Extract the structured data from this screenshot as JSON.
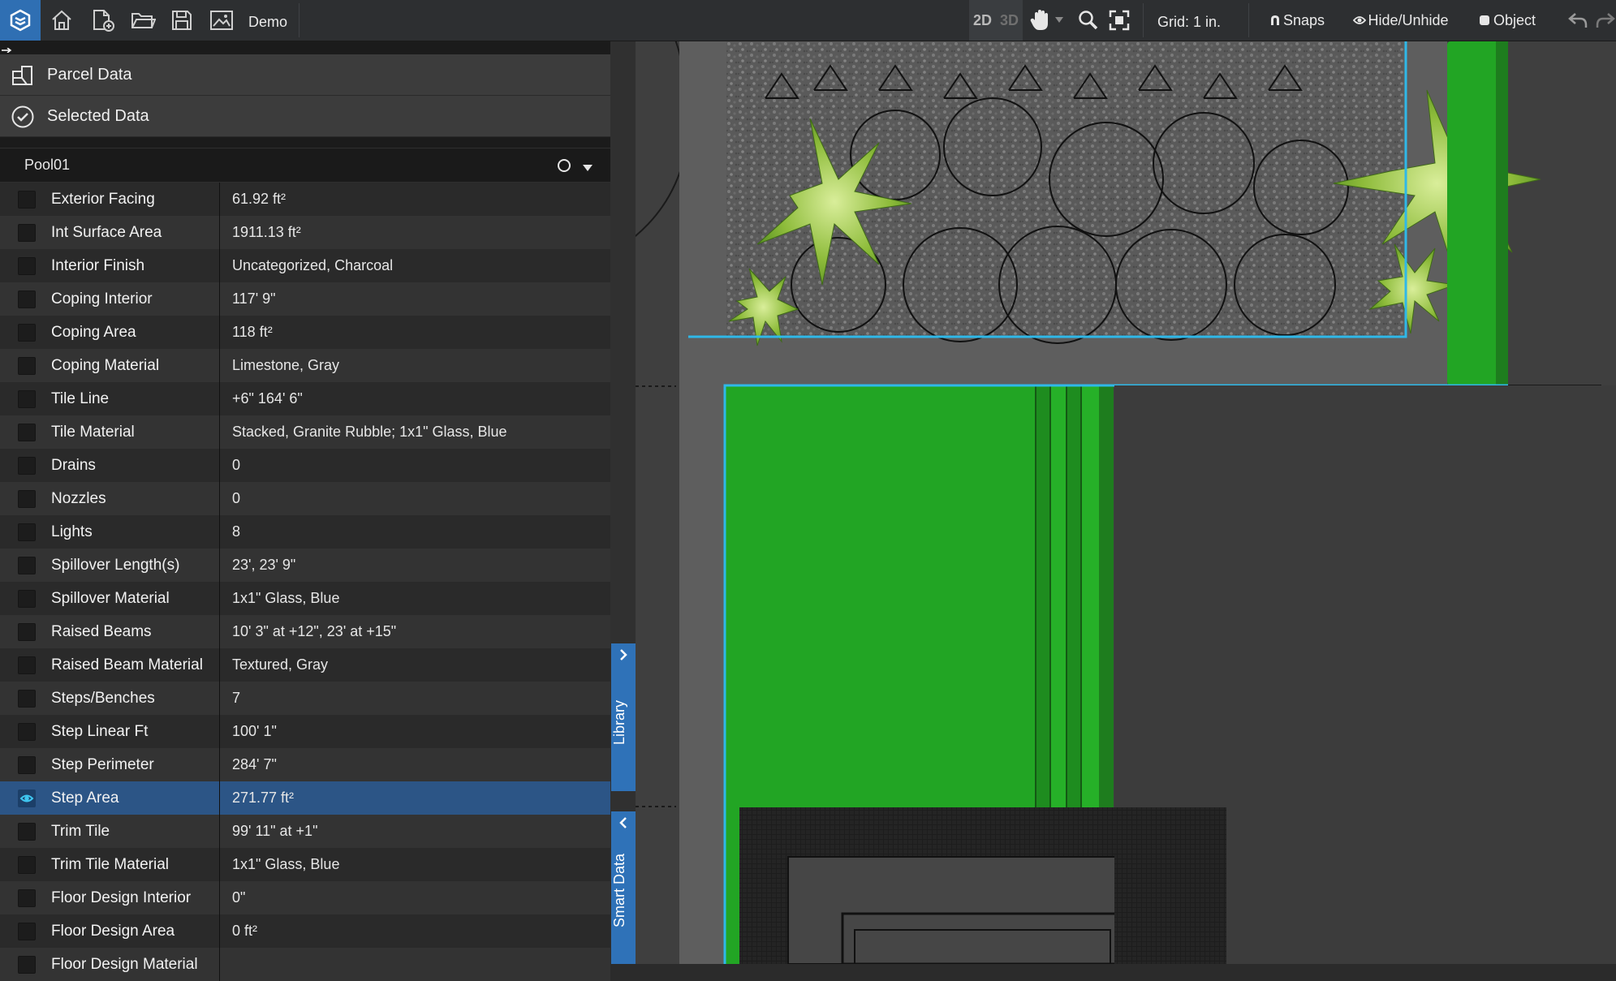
{
  "toolbar": {
    "project_name": "Demo",
    "view_2d": "2D",
    "view_3d": "3D",
    "grid_label": "Grid: 1 in.",
    "snaps_label": "Snaps",
    "hide_unhide_label": "Hide/Unhide",
    "object_label": "Object"
  },
  "panel": {
    "parcel_data_label": "Parcel Data",
    "selected_data_label": "Selected Data",
    "pool_name": "Pool01",
    "rows": [
      {
        "label": "Exterior Facing",
        "value": "61.92 ft²"
      },
      {
        "label": "Int Surface Area",
        "value": "1911.13 ft²"
      },
      {
        "label": "Interior Finish",
        "value": "Uncategorized, Charcoal"
      },
      {
        "label": "Coping Interior",
        "value": "117' 9\""
      },
      {
        "label": "Coping Area",
        "value": "118 ft²"
      },
      {
        "label": "Coping Material",
        "value": "Limestone, Gray"
      },
      {
        "label": "Tile Line",
        "value": "+6\" 164' 6\""
      },
      {
        "label": "Tile Material",
        "value": "Stacked, Granite Rubble; 1x1\" Glass, Blue"
      },
      {
        "label": "Drains",
        "value": "0"
      },
      {
        "label": "Nozzles",
        "value": "0"
      },
      {
        "label": "Lights",
        "value": "8"
      },
      {
        "label": "Spillover Length(s)",
        "value": "23', 23' 9\""
      },
      {
        "label": "Spillover Material",
        "value": "1x1\" Glass, Blue"
      },
      {
        "label": "Raised Beams",
        "value": "10' 3\" at +12\", 23' at +15\""
      },
      {
        "label": "Raised Beam Material",
        "value": "Textured, Gray"
      },
      {
        "label": "Steps/Benches",
        "value": "7"
      },
      {
        "label": "Step Linear Ft",
        "value": "100' 1\""
      },
      {
        "label": "Step Perimeter",
        "value": "284' 7\""
      },
      {
        "label": "Step Area",
        "value": "271.77 ft²",
        "selected": true
      },
      {
        "label": "Trim Tile",
        "value": "99' 11\" at +1\""
      },
      {
        "label": "Trim Tile Material",
        "value": "1x1\" Glass, Blue"
      },
      {
        "label": "Floor Design Interior",
        "value": "0\""
      },
      {
        "label": "Floor Design Area",
        "value": "0 ft²"
      },
      {
        "label": "Floor Design Material",
        "value": ""
      }
    ]
  },
  "side_tabs": {
    "library_label": "Library",
    "smart_data_label": "Smart Data"
  },
  "colors": {
    "accent": "#2f72b8",
    "selected_row": "#2c5586",
    "grass": "#22a524",
    "outline": "#2fb8e8"
  }
}
